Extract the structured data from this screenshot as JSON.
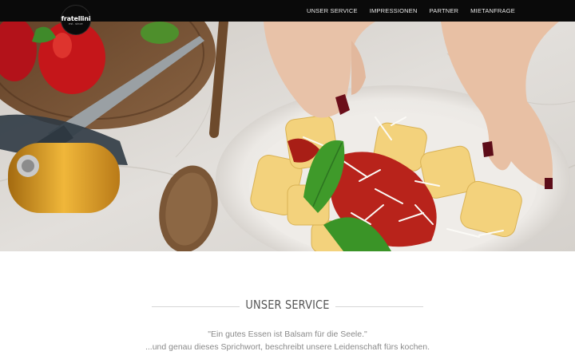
{
  "nav": {
    "logo_text": "fratellini",
    "logo_sub": "est. since",
    "items": [
      {
        "label": "UNSER SERVICE"
      },
      {
        "label": "IMPRESSIONEN"
      },
      {
        "label": "PARTNER"
      },
      {
        "label": "MIETANFRAGE"
      }
    ]
  },
  "section": {
    "heading": "UNSER SERVICE",
    "quote_line1": "\"Ein gutes Essen ist Balsam für die Seele.\"",
    "quote_line2": "...und genau dieses Sprichwort, beschreibt unsere Leidenschaft fürs kochen."
  },
  "colors": {
    "nav_bg": "#0a0a0a",
    "heading": "#555555",
    "text": "#8a8a8a"
  }
}
